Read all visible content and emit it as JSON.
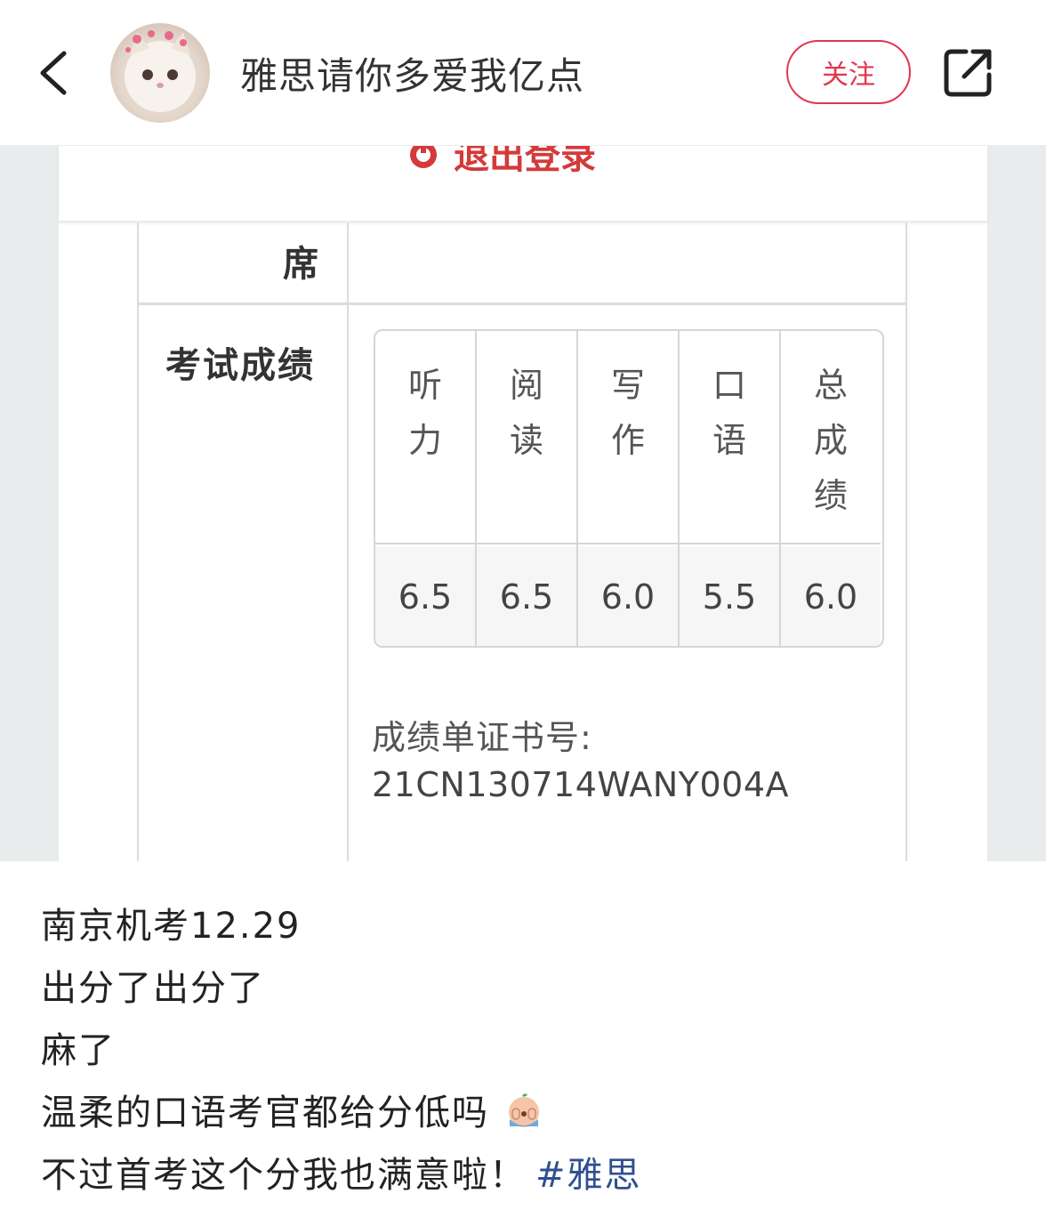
{
  "header": {
    "author": "雅思请你多爱我亿点",
    "follow_label": "关注",
    "back_icon": "chevron-left-icon",
    "share_icon": "share-icon",
    "accent": "#e0374e"
  },
  "screenshot": {
    "logout_label": "退出登录",
    "seat_label": "席",
    "score_label": "考试成绩",
    "columns": [
      {
        "head": "听力",
        "value": "6.5"
      },
      {
        "head": "阅读",
        "value": "6.5"
      },
      {
        "head": "写作",
        "value": "6.0"
      },
      {
        "head": "口语",
        "value": "5.5"
      },
      {
        "head": "总成绩",
        "value": "6.0"
      }
    ],
    "cert_label": "成绩单证书号:",
    "cert_number": "21CN130714WANY004A"
  },
  "post": {
    "lines": [
      "南京机考12.29",
      "出分了出分了",
      "麻了",
      "温柔的口语考官都给分低吗",
      "不过首考这个分我也满意啦！"
    ],
    "hashtag": "#雅思",
    "hashtag_color": "#2f4f8f"
  }
}
